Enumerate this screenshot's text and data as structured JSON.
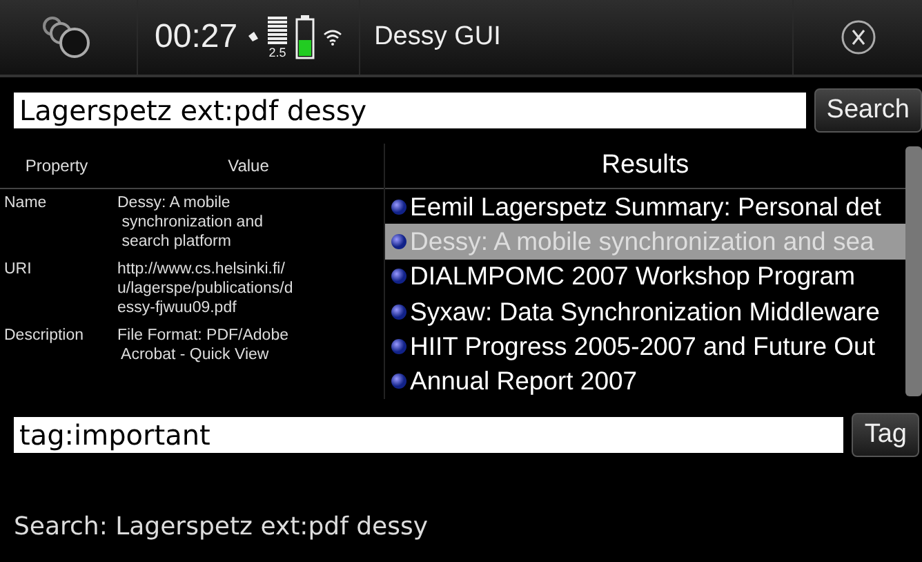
{
  "status_bar": {
    "time": "00:27",
    "signal_label": "2.5",
    "title": "Dessy GUI"
  },
  "search": {
    "value": "Lagerspetz ext:pdf dessy",
    "button": "Search"
  },
  "properties": {
    "columns": [
      "Property",
      "Value"
    ],
    "rows": [
      {
        "property": "Name",
        "value": "Dessy: A mobile\n synchronization and\n search platform"
      },
      {
        "property": "URI",
        "value": "http://www.cs.helsinki.fi/\nu/lagerspe/publications/d\nessy-fjwuu09.pdf"
      },
      {
        "property": "Description",
        "value": "File Format: PDF/Adobe\n Acrobat - Quick View"
      }
    ]
  },
  "results": {
    "title": "Results",
    "items": [
      {
        "label": "Eemil Lagerspetz Summary: Personal det",
        "selected": false
      },
      {
        "label": "Dessy: A mobile synchronization and sea",
        "selected": true
      },
      {
        "label": "DIALMPOMC 2007 Workshop Program",
        "selected": false
      },
      {
        "label": "Syxaw: Data Synchronization Middleware",
        "selected": false
      },
      {
        "label": "HIIT Progress 2005-2007 and Future Out",
        "selected": false
      },
      {
        "label": "Annual Report 2007",
        "selected": false
      }
    ]
  },
  "tag": {
    "value": "tag:important",
    "button": "Tag"
  },
  "status_text": "Search: Lagerspetz ext:pdf dessy"
}
